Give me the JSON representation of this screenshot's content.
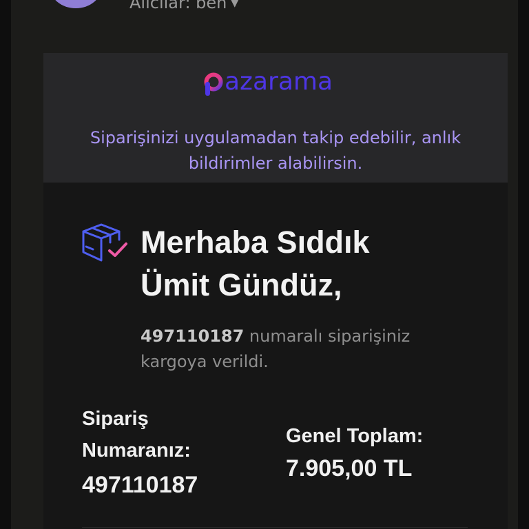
{
  "header": {
    "recipients": "Alıcılar: ben"
  },
  "banner": {
    "logo_text": "pazarama",
    "message": "Siparişinizi uygulamadan takip edebilir, anlık bildirimler alabilirsin."
  },
  "greeting": {
    "text": "Merhaba Sıddık Ümit Gündüz,"
  },
  "status": {
    "order_number": "497110187",
    "message": " numaralı siparişiniz kargoya verildi."
  },
  "order": {
    "label": "Sipariş Numaranız:",
    "number": "497110187",
    "total_label": "Genel Toplam:",
    "total": "7.905,00 TL"
  },
  "colors": {
    "background": "#121212",
    "banner": "#272729",
    "accent_purple": "#a995f4",
    "brand_blue": "#4e36e6",
    "brand_pink": "#e8337a",
    "avatar": "#8f7ed6"
  },
  "icons": {
    "header_toggle": "chevron-down-icon",
    "greeting": "package-check-icon"
  }
}
